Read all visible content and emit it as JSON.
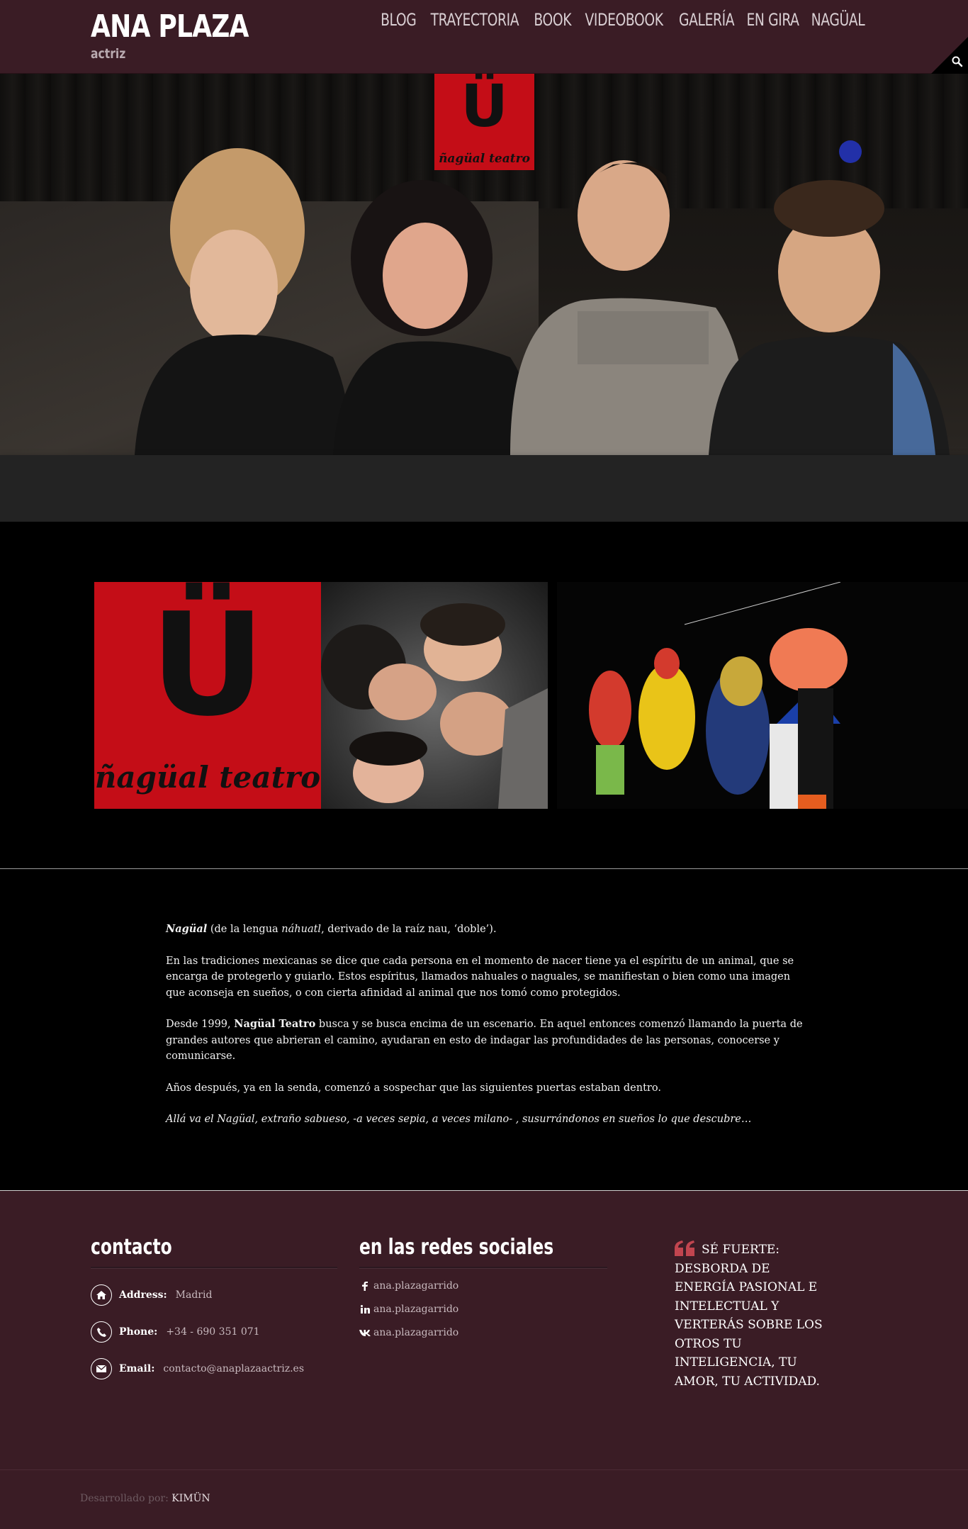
{
  "header": {
    "title": "ANA PLAZA",
    "subtitle": "actriz",
    "nav": [
      "BLOG",
      "TRAYECTORIA",
      "BOOK",
      "VIDEOBOOK",
      "GALERÍA",
      "EN GIRA",
      "NAGÜAL"
    ],
    "search_icon": "search-icon"
  },
  "hero": {
    "logo_letter": "Ü",
    "logo_text": "ñagüal teatro"
  },
  "gallery": {
    "logo_letter": "Ü",
    "logo_text": "ñagüal teatro"
  },
  "article": {
    "p1_term": "Nagüal",
    "p1_mid": " (de la lengua ",
    "p1_lang": "náhuatl",
    "p1_end": ", derivado de la raíz nau, ‘doble’).",
    "p2": "En las tradiciones mexicanas se dice que cada persona en el momento de nacer tiene ya el espíritu de un animal, que se encarga de protegerlo y guiarlo. Estos espíritus, llamados nahuales o naguales, se manifiestan o bien como una imagen que aconseja en sueños, o con cierta afinidad al animal que nos tomó como protegidos.",
    "p3_start": "Desde 1999, ",
    "p3_bold": "Nagüal Teatro",
    "p3_end": " busca y se busca encima de un escenario. En aquel entonces comenzó llamando la puerta de grandes autores que abrieran el camino, ayudaran en esto de indagar las profundidades de las personas, conocerse y comunicarse.",
    "p4": "Años después, ya en la senda, comenzó a sospechar que las siguientes puertas estaban dentro.",
    "p5": "Allá va el Nagüal, extraño sabueso, -a veces sepia, a veces milano- , susurrándonos en sueños lo que descubre…"
  },
  "footer": {
    "contact_title": "contacto",
    "address_label": "Address:",
    "address_value": "Madrid",
    "phone_label": "Phone:",
    "phone_value": "+34 - 690 351 071",
    "email_label": "Email:",
    "email_value": "contacto@anaplazaactriz.es",
    "social_title": "en las redes sociales",
    "social": [
      {
        "icon": "facebook-icon",
        "label": "ana.plazagarrido"
      },
      {
        "icon": "linkedin-icon",
        "label": "ana.plazagarrido"
      },
      {
        "icon": "vk-icon",
        "label": "ana.plazagarrido"
      }
    ],
    "quote": "SÉ FUERTE: DESBORDA DE ENERGÍA PASIONAL E INTELECTUAL Y VERTERÁS SOBRE LOS OTROS TU INTELIGENCIA, TU AMOR, TU ACTIVIDAD."
  },
  "bottom": {
    "credit_prefix": "Desarrollado por: ",
    "credit_link": "KIMÜN"
  },
  "colors": {
    "header_bg": "#3a1c25",
    "logo_red": "#c40d17",
    "quote_accent": "#c1454f"
  }
}
